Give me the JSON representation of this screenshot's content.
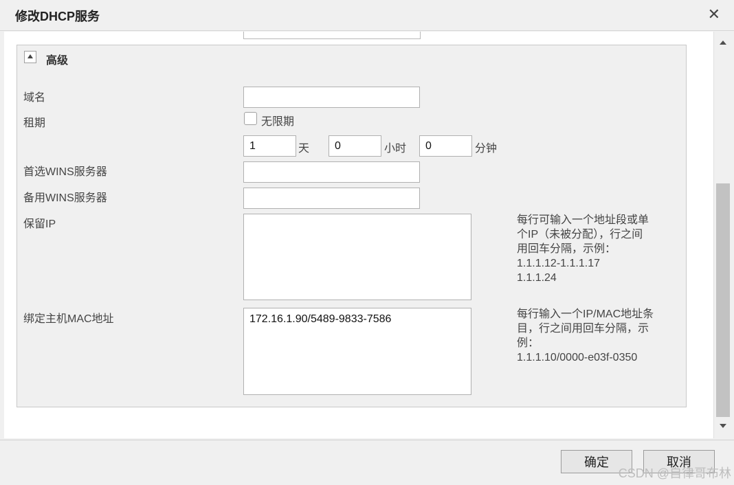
{
  "dialog": {
    "title": "修改DHCP服务",
    "close_glyph": "✕"
  },
  "advanced": {
    "title": "高级",
    "domain_label": "域名",
    "domain_value": "",
    "lease_label": "租期",
    "unlimited_label": "无限期",
    "unlimited_checked": false,
    "lease_days": "1",
    "days_unit": "天",
    "lease_hours": "0",
    "hours_unit": "小时",
    "lease_minutes": "0",
    "minutes_unit": "分钟",
    "primary_wins_label": "首选WINS服务器",
    "primary_wins_value": "",
    "backup_wins_label": "备用WINS服务器",
    "backup_wins_value": "",
    "reserved_ip_label": "保留IP",
    "reserved_ip_value": "",
    "reserved_ip_hint": [
      "每行可输入一个地址段或单",
      "个IP（未被分配），行之间",
      "用回车分隔，示例：",
      "1.1.1.12-1.1.1.17",
      "1.1.1.24"
    ],
    "mac_binding_label": "绑定主机MAC地址",
    "mac_binding_value": "172.16.1.90/5489-9833-7586",
    "mac_binding_hint": [
      "每行输入一个IP/MAC地址条",
      "目，行之间用回车分隔，示",
      "例：",
      "1.1.1.10/0000-e03f-0350"
    ]
  },
  "footer": {
    "confirm_label": "确定",
    "cancel_label": "取消"
  },
  "watermark": "CSDN @自律哥布林",
  "icons": {
    "collapse": "triangle-up-icon",
    "close": "close-icon",
    "scroll_up": "chevron-up-icon",
    "scroll_down": "chevron-down-icon"
  }
}
